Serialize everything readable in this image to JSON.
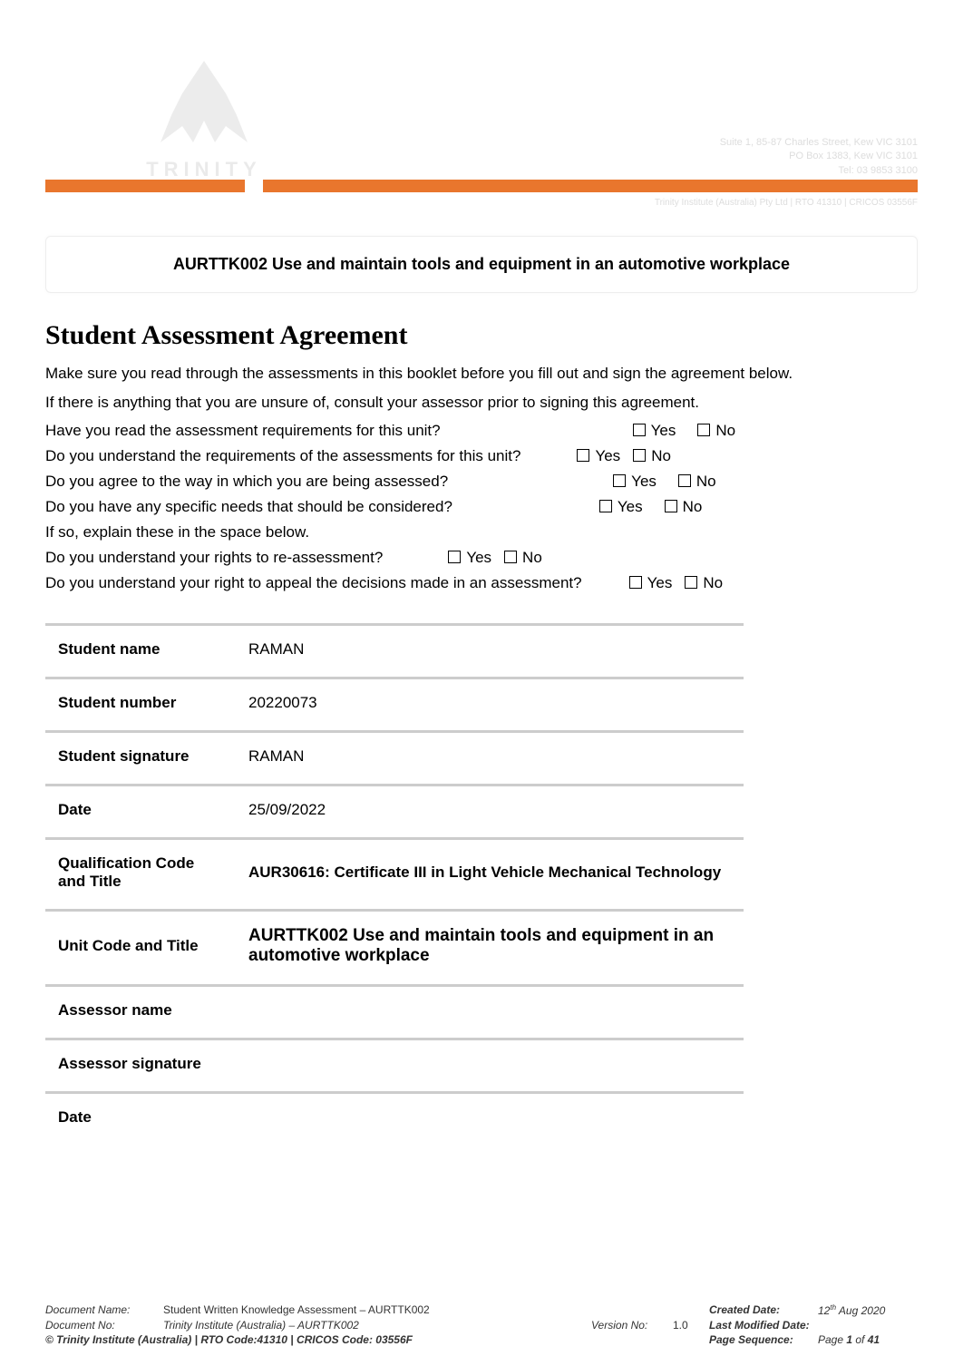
{
  "header": {
    "logo_text": "TRINITY",
    "addr_line1": "Suite 1, 85-87 Charles Street, Kew VIC 3101",
    "addr_line2": "PO Box 1383, Kew VIC 3101",
    "addr_line3": "Tel: 03 9853 3100",
    "sub_line": "Trinity Institute (Australia) Pty Ltd | RTO 41310 | CRICOS 03556F"
  },
  "unit_title": "AURTTK002 Use and maintain tools and equipment in an automotive workplace",
  "section_heading": "Student Assessment Agreement",
  "intro": {
    "line1": "Make sure you read through the assessments in this booklet before you fill out and sign the agreement below.",
    "line2": "If there is anything that you are unsure of, consult your assessor prior to signing this agreement."
  },
  "questions": {
    "q1": "Have you read the assessment requirements for this unit?",
    "q2": "Do you understand the requirements of the assessments for this unit?",
    "q3": "Do you agree to the way in which you are being assessed?",
    "q4": "Do you have any specific needs that should be considered?",
    "q5": "If so, explain these in the space below.",
    "q6": "Do you understand your rights to re-assessment?",
    "q7": "Do you understand your right to appeal the decisions made in an assessment?"
  },
  "yn": {
    "yes": "Yes",
    "no": "No"
  },
  "table": {
    "student_name_label": "Student name",
    "student_name_value": "RAMAN",
    "student_number_label": "Student number",
    "student_number_value": "20220073",
    "student_signature_label": "Student signature",
    "student_signature_value": "RAMAN",
    "date_label": "Date",
    "date_value": "25/09/2022",
    "qual_label": "Qualification Code and Title",
    "qual_value": "AUR30616: Certificate III in Light Vehicle Mechanical Technology",
    "unit_label": "Unit Code and Title",
    "unit_value": "AURTTK002 Use and maintain tools and equipment in an automotive workplace",
    "assessor_name_label": "Assessor name",
    "assessor_name_value": "",
    "assessor_sig_label": "Assessor signature",
    "assessor_sig_value": "",
    "date2_label": "Date",
    "date2_value": ""
  },
  "footer": {
    "doc_name_label": "Document Name:",
    "doc_name_value": "Student Written Knowledge Assessment – AURTTK002",
    "doc_no_label": "Document No:",
    "doc_no_value": "Trinity Institute (Australia) – AURTTK002",
    "version_label": "Version No:",
    "version_value": "1.0",
    "created_label": "Created Date:",
    "created_value_pre": "12",
    "created_value_sup": "th",
    "created_value_post": " Aug 2020",
    "modified_label": "Last Modified Date:",
    "modified_value": "",
    "copyright": "© Trinity Institute (Australia) | RTO Code:41310 | CRICOS Code: 03556F",
    "page_seq_label": "Page Sequence:",
    "page_seq_value_pre": "Page ",
    "page_seq_value_cur": "1",
    "page_seq_value_mid": " of ",
    "page_seq_value_tot": "41"
  },
  "watermark": ""
}
